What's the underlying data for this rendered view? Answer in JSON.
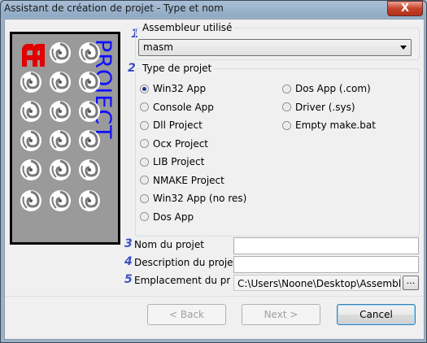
{
  "window": {
    "title": "Assistant de création de projet - Type et nom",
    "close_symbol": "X"
  },
  "picture": {
    "word": "PROJECT",
    "logo_text": "AA",
    "colors": {
      "logo": "#e00000",
      "word": "#1010ff"
    }
  },
  "steps": [
    "1",
    "2",
    "3",
    "4",
    "5"
  ],
  "assembler": {
    "group_title": "Assembleur utilisé",
    "selected": "masm"
  },
  "project_type": {
    "group_title": "Type de projet",
    "left_options": [
      {
        "label": "Win32 App",
        "checked": true
      },
      {
        "label": "Console App",
        "checked": false
      },
      {
        "label": "Dll Project",
        "checked": false
      },
      {
        "label": "Ocx Project",
        "checked": false
      },
      {
        "label": "LIB Project",
        "checked": false
      },
      {
        "label": "NMAKE Project",
        "checked": false
      },
      {
        "label": "Win32 App (no res)",
        "checked": false
      },
      {
        "label": "Dos App",
        "checked": false
      }
    ],
    "right_options": [
      {
        "label": "Dos App (.com)",
        "checked": false
      },
      {
        "label": "Driver (.sys)",
        "checked": false
      },
      {
        "label": "Empty make.bat",
        "checked": false
      }
    ]
  },
  "fields": {
    "name_label": "Nom du projet",
    "name_value": "",
    "description_label": "Description du projet",
    "description_value": "",
    "location_label": "Emplacement du projet",
    "location_value": "C:\\Users\\Noone\\Desktop\\Assembleur",
    "browse_label": "..."
  },
  "buttons": {
    "back": "< Back",
    "next": "Next >",
    "cancel": "Cancel"
  }
}
